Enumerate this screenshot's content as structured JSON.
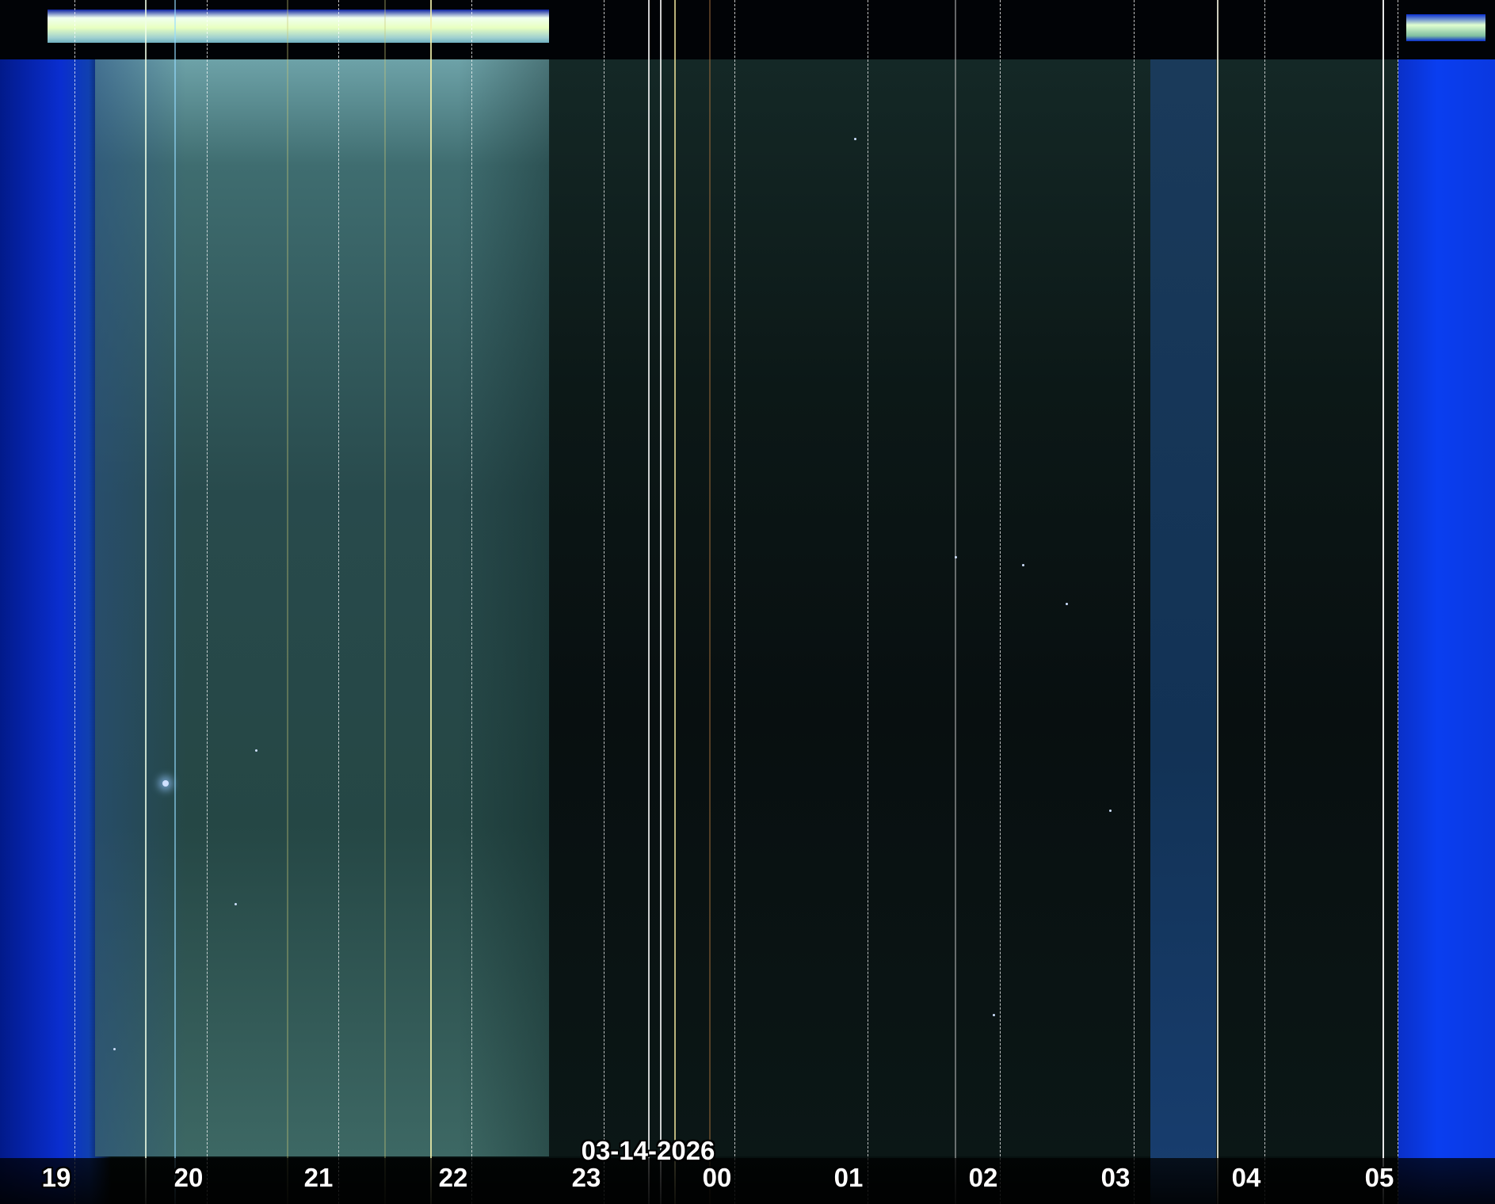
{
  "keogram": {
    "date_label": "03-14-2026",
    "hour_labels": [
      "19",
      "20",
      "21",
      "22",
      "23",
      "00",
      "01",
      "02",
      "03",
      "04",
      "05"
    ]
  }
}
